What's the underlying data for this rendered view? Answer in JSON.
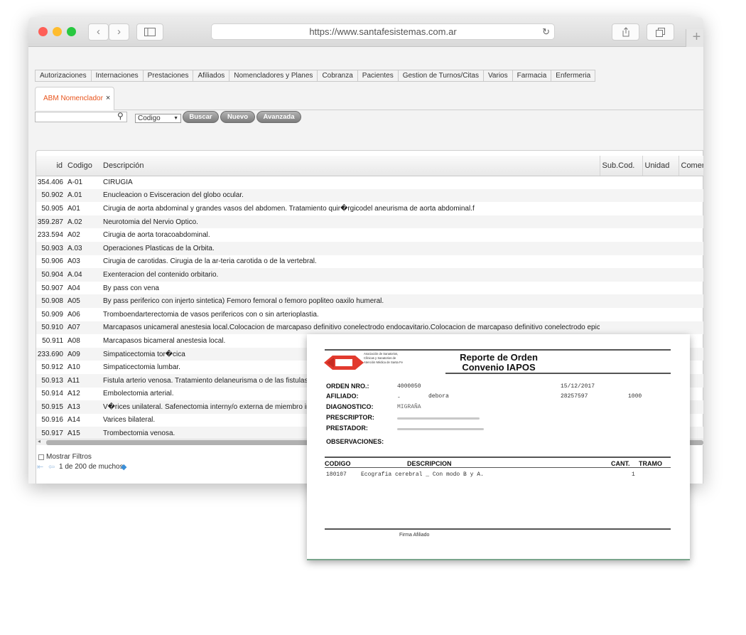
{
  "browser": {
    "url": "https://www.santafesistemas.com.ar",
    "colors": {
      "close": "#fe5f57",
      "minimize": "#febc2e",
      "zoom": "#28c840"
    },
    "icons": [
      "back-icon",
      "forward-icon",
      "sidebar-icon",
      "reload-icon",
      "share-icon",
      "tabs-icon",
      "new-tab-icon"
    ]
  },
  "menu": [
    "Autorizaciones",
    "Internaciones",
    "Prestaciones",
    "Afiliados",
    "Nomencladores y Planes",
    "Cobranza",
    "Pacientes",
    "Gestion de Turnos/Citas",
    "Varios",
    "Farmacia",
    "Enfermeria"
  ],
  "tab": {
    "label": "ABM Nomenclador",
    "close": "×",
    "accent": "#e8541c"
  },
  "toolbar": {
    "select_value": "Codigo",
    "buscar": "Buscar",
    "nuevo": "Nuevo",
    "avanzada": "Avanzada"
  },
  "grid": {
    "columns": [
      "id",
      "Codigo",
      "Descripción",
      "Sub.Cod.",
      "Unidad",
      "Comer"
    ],
    "rows": [
      [
        "354.406",
        "A-01",
        "CIRUGIA"
      ],
      [
        "50.902",
        "A.01",
        "Enucleacion o Evisceracion del globo ocular."
      ],
      [
        "50.905",
        "A01",
        "Cirugia de aorta abdominal y grandes vasos del abdomen. Tratamiento quir�rgicodel aneurisma de aorta abdominal.f"
      ],
      [
        "359.287",
        "A.02",
        "Neurotomia del Nervio Optico."
      ],
      [
        "233.594",
        "A02",
        "Cirugia de aorta toracoabdominal."
      ],
      [
        "50.903",
        "A.03",
        "Operaciones Plasticas de la Orbita."
      ],
      [
        "50.906",
        "A03",
        "Cirugia de carotidas. Cirugia de la ar-teria carotida o de la vertebral."
      ],
      [
        "50.904",
        "A.04",
        "Exenteracion del contenido orbitario."
      ],
      [
        "50.907",
        "A04",
        "By pass con vena"
      ],
      [
        "50.908",
        "A05",
        "By pass periferico con injerto sintetica) Femoro femoral o femoro popliteo oaxilo humeral."
      ],
      [
        "50.909",
        "A06",
        "Tromboendarterectomia de vasos perifericos con o sin arterioplastia."
      ],
      [
        "50.910",
        "A07",
        "Marcapasos unicameral anestesia local.Colocacion de marcapaso definitivo conelectrodo endocavitario.Colocacion de marcapaso definitivo conelectrodo epicardico.Col"
      ],
      [
        "50.911",
        "A08",
        "Marcapasos bicameral anestesia local."
      ],
      [
        "233.690",
        "A09",
        "Simpaticectomia tor�cica"
      ],
      [
        "50.912",
        "A10",
        "Simpaticectomia lumbar."
      ],
      [
        "50.913",
        "A11",
        "Fistula arterio venosa. Tratamiento delaneurisma o de las fistulas arte"
      ],
      [
        "50.914",
        "A12",
        "Embolectomia arterial."
      ],
      [
        "50.915",
        "A13",
        "V�rices unilateral. Safenectomia interny/o externa de miembro inferior"
      ],
      [
        "50.916",
        "A14",
        "Varices bilateral."
      ],
      [
        "50.917",
        "A15",
        "Trombectomia venosa."
      ]
    ]
  },
  "footer": {
    "filter_label": "Mostrar Filtros",
    "pagination": "1 de 200 de muchos"
  },
  "report": {
    "title_1": "Reporte de Orden",
    "title_2": "Convenio IAPOS",
    "org": "Asociación de Sanatorios, Clínicas y Sanatorios de Atención Médica de Santa Fe",
    "labels": {
      "orden": "ORDEN NRO.:",
      "afiliado": "AFILIADO:",
      "diagnostico": "DIAGNOSTICO:",
      "prescriptor": "PRESCRIPTOR:",
      "prestador": "PRESTADOR:",
      "observaciones": "OBSERVACIONES:"
    },
    "values": {
      "orden": "4000050",
      "fecha": "15/12/2017",
      "afiliado_sep": "-",
      "afiliado_nombre": "debora",
      "afiliado_doc": "28257597",
      "afiliado_num": "1000",
      "diagnostico": "MIGRAÑA"
    },
    "table_headers": [
      "CODIGO",
      "DESCRIPCION",
      "CANT.",
      "TRAMO"
    ],
    "item": {
      "codigo": "180107",
      "descripcion": "Ecografia cerebral _ Con modo B y A.",
      "cant": "1"
    },
    "signature": "Firma Afiliado"
  }
}
